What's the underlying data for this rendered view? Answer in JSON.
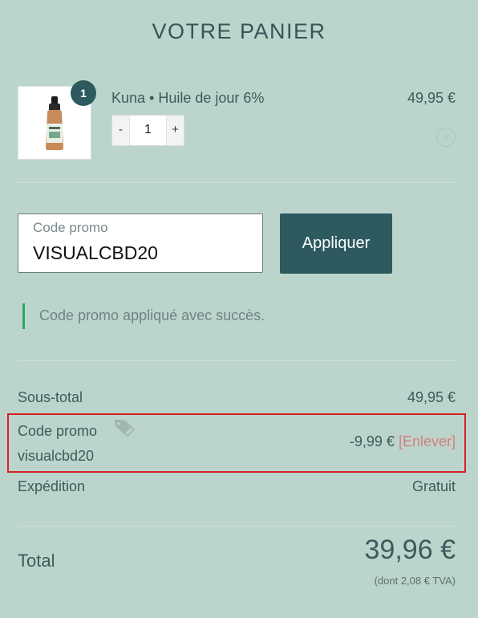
{
  "cart": {
    "title": "VOTRE PANIER",
    "item": {
      "quantity_badge": "1",
      "name": "Kuna • Huile de jour 6%",
      "decrement": "-",
      "quantity": "1",
      "increment": "+",
      "price": "49,95 €",
      "remove": "x"
    }
  },
  "promo": {
    "label": "Code promo",
    "value": "VISUALCBD20",
    "apply_label": "Appliquer",
    "success_message": "Code promo appliqué avec succès."
  },
  "summary": {
    "subtotal_label": "Sous-total",
    "subtotal_value": "49,95 €",
    "promo_label": "Code promo",
    "promo_code": "visualcbd20",
    "promo_discount": "-9,99 €",
    "promo_remove": "[Enlever]",
    "shipping_label": "Expédition",
    "shipping_value": "Gratuit",
    "total_label": "Total",
    "total_value": "39,96 €",
    "tax_note": "(dont 2,08 € TVA)"
  },
  "icons": {
    "tag": "tag-icon"
  },
  "colors": {
    "background": "#bcd5cc",
    "primary": "#2c5a5f",
    "success": "#2eaa5a",
    "remove_link": "#d37f7c",
    "highlight": "#d61f26"
  }
}
